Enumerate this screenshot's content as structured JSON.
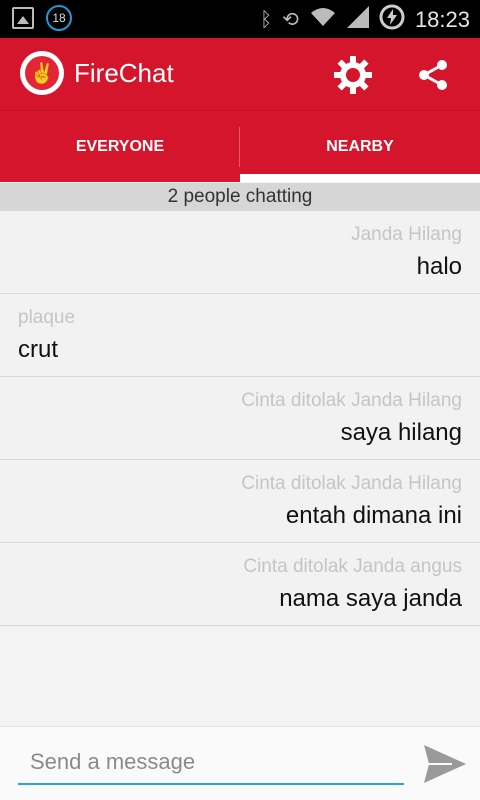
{
  "status_bar": {
    "notification_count": "18",
    "time": "18:23",
    "icons": [
      "gallery-icon",
      "bluetooth-icon",
      "rotation-icon",
      "wifi-icon",
      "signal-icon",
      "battery-charging-icon"
    ]
  },
  "app": {
    "title": "FireChat",
    "accent_color": "#d5152b"
  },
  "tabs": [
    {
      "label": "EVERYONE",
      "selected": false
    },
    {
      "label": "NEARBY",
      "selected": true
    }
  ],
  "chatting_count": "2 people chatting",
  "messages": [
    {
      "sender": "Janda Hilang",
      "text": "halo",
      "align": "right"
    },
    {
      "sender": "plaque",
      "text": "crut",
      "align": "left"
    },
    {
      "sender": "Cinta ditolak Janda Hilang",
      "text": "saya hilang",
      "align": "right"
    },
    {
      "sender": "Cinta ditolak Janda Hilang",
      "text": "entah dimana ini",
      "align": "right"
    },
    {
      "sender": "Cinta ditolak Janda angus",
      "text": "nama saya janda",
      "align": "right"
    }
  ],
  "compose": {
    "placeholder": "Send a message",
    "value": ""
  }
}
